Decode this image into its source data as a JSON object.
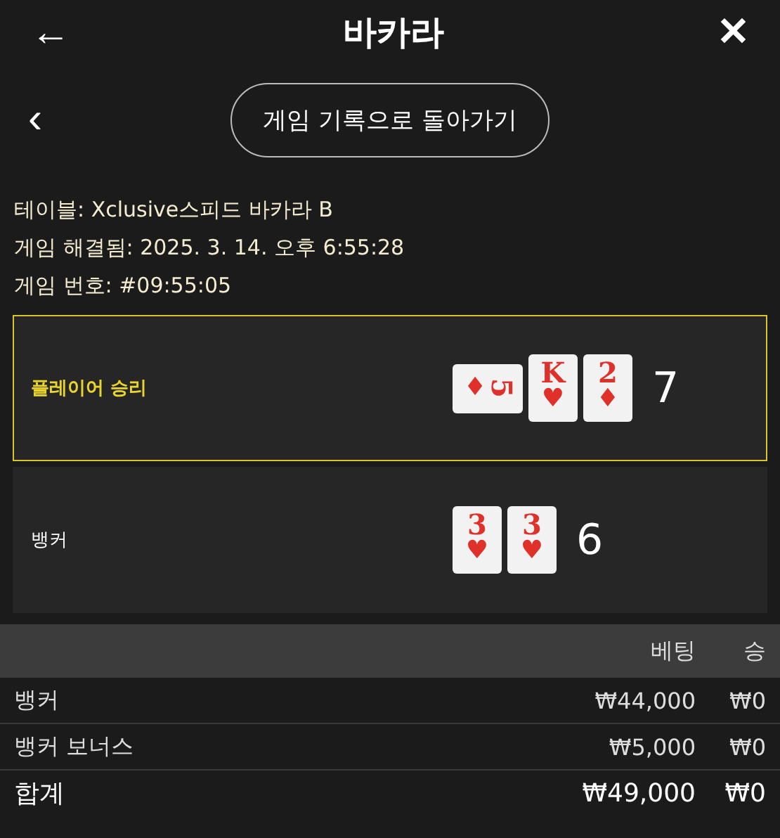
{
  "header": {
    "back": "←",
    "title": "바카라",
    "close": "✕"
  },
  "nav": {
    "back": "‹",
    "button": "게임 기록으로 돌아가기"
  },
  "info": [
    {
      "label": "테이블:",
      "value": "Xclusive스피드 바카라 B"
    },
    {
      "label": "게임 해결됨:",
      "value": "2025. 3. 14. 오후 6:55:28"
    },
    {
      "label": "게임 번호:",
      "value": "#09:55:05"
    }
  ],
  "hands": [
    {
      "label": "플레이어 승리",
      "winner": true,
      "score": "7",
      "cards": [
        {
          "rank": "5",
          "suit": "♦",
          "rotated": true
        },
        {
          "rank": "K",
          "suit": "♥",
          "rotated": false
        },
        {
          "rank": "2",
          "suit": "♦",
          "rotated": false
        }
      ]
    },
    {
      "label": "뱅커",
      "winner": false,
      "score": "6",
      "cards": [
        {
          "rank": "3",
          "suit": "♥",
          "rotated": false
        },
        {
          "rank": "3",
          "suit": "♥",
          "rotated": false
        }
      ]
    }
  ],
  "table": {
    "columns": [
      "베팅",
      "승"
    ],
    "rows": [
      {
        "name": "뱅커",
        "bet": "₩44,000",
        "win": "₩0",
        "total": false
      },
      {
        "name": "뱅커 보너스",
        "bet": "₩5,000",
        "win": "₩0",
        "total": false
      },
      {
        "name": "합계",
        "bet": "₩49,000",
        "win": "₩0",
        "total": true
      }
    ]
  }
}
